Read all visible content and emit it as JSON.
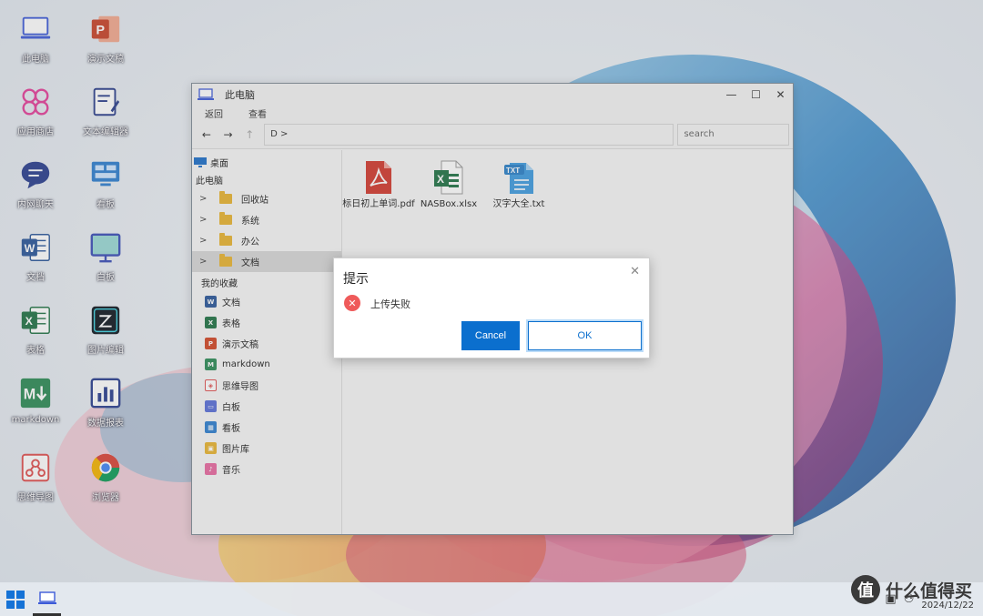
{
  "desktop": {
    "icons": [
      {
        "label": "此电脑",
        "icon": "computer-icon"
      },
      {
        "label": "演示文稿",
        "icon": "powerpoint-icon"
      },
      {
        "label": "应用商店",
        "icon": "app-store-icon"
      },
      {
        "label": "文本编辑器",
        "icon": "text-editor-icon"
      },
      {
        "label": "内网聊天",
        "icon": "chat-icon"
      },
      {
        "label": "看板",
        "icon": "dashboard-icon"
      },
      {
        "label": "文档",
        "icon": "word-icon"
      },
      {
        "label": "白板",
        "icon": "whiteboard-icon"
      },
      {
        "label": "表格",
        "icon": "excel-icon"
      },
      {
        "label": "图片编辑",
        "icon": "image-editor-icon"
      },
      {
        "label": "markdown",
        "icon": "markdown-icon"
      },
      {
        "label": "数据报表",
        "icon": "report-icon"
      },
      {
        "label": "思维导图",
        "icon": "mindmap-icon"
      },
      {
        "label": "浏览器",
        "icon": "browser-icon"
      }
    ]
  },
  "window": {
    "title": "此电脑",
    "menu": {
      "back": "返回",
      "view": "查看"
    },
    "nav": {
      "back_glyph": "←",
      "forward_glyph": "→",
      "up_glyph": "↑"
    },
    "address": "D >",
    "search_placeholder": "search",
    "controls": {
      "minimize": "—",
      "maximize": "☐",
      "close": "✕"
    },
    "sidebar": {
      "desktop": "桌面",
      "this_pc": "此电脑",
      "tree": [
        {
          "label": "回收站",
          "selected": false
        },
        {
          "label": "系统",
          "selected": false
        },
        {
          "label": "办公",
          "selected": false
        },
        {
          "label": "文档",
          "selected": true
        }
      ],
      "favorites_title": "我的收藏",
      "favorites": [
        {
          "label": "文档",
          "icon": "word-icon",
          "color": "#2b579a",
          "glyph": "W"
        },
        {
          "label": "表格",
          "icon": "excel-icon",
          "color": "#217346",
          "glyph": "X"
        },
        {
          "label": "演示文稿",
          "icon": "powerpoint-icon",
          "color": "#d24726",
          "glyph": "P"
        },
        {
          "label": "markdown",
          "icon": "markdown-icon",
          "color": "#2e8b57",
          "glyph": "M"
        },
        {
          "label": "思维导图",
          "icon": "mindmap-icon",
          "color": "#e05050",
          "glyph": "◈"
        },
        {
          "label": "白板",
          "icon": "whiteboard-icon",
          "color": "#5a6fd8",
          "glyph": "▭"
        },
        {
          "label": "看板",
          "icon": "dashboard-icon",
          "color": "#2f7fd0",
          "glyph": "▦"
        },
        {
          "label": "图片库",
          "icon": "gallery-icon",
          "color": "#e8b431",
          "glyph": "▣"
        },
        {
          "label": "音乐",
          "icon": "music-icon",
          "color": "#e86aa0",
          "glyph": "♪"
        }
      ]
    },
    "files": [
      {
        "name": "标日初上单词.pdf",
        "type": "pdf",
        "icon": "pdf-file-icon"
      },
      {
        "name": "NASBox.xlsx",
        "type": "xlsx",
        "icon": "excel-file-icon"
      },
      {
        "name": "汉字大全.txt",
        "type": "txt",
        "icon": "txt-file-icon"
      }
    ]
  },
  "dialog": {
    "title": "提示",
    "message": "上传失败",
    "close_glyph": "✕",
    "error_glyph": "✕",
    "cancel_label": "Cancel",
    "ok_label": "OK"
  },
  "taskbar": {
    "date": "2024/12/22"
  },
  "watermark": {
    "logo": "值",
    "text": "什么值得买"
  },
  "colors": {
    "accent": "#0b6fce",
    "error": "#ef5a5a"
  }
}
